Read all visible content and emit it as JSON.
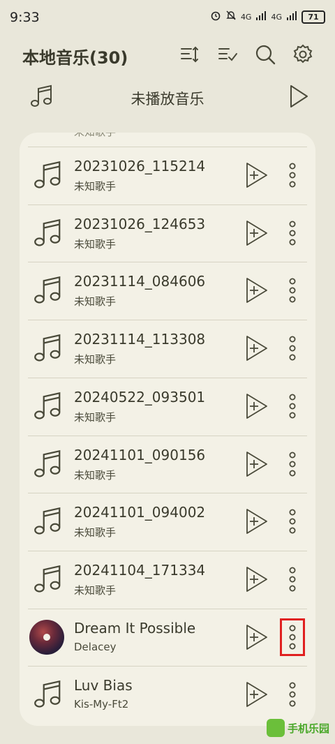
{
  "status_bar": {
    "time": "9:33",
    "signal_1": "4G",
    "signal_2": "4G",
    "battery": "71"
  },
  "header": {
    "title": "本地音乐(30)",
    "icons": [
      "sort-icon",
      "multi-select-icon",
      "search-icon",
      "settings-icon"
    ]
  },
  "unplayed": {
    "label": "未播放音乐"
  },
  "list": {
    "partial_top_text": "未知歌手",
    "rows": [
      {
        "title": "20231026_115214",
        "artist": "未知歌手",
        "art": false
      },
      {
        "title": "20231026_124653",
        "artist": "未知歌手",
        "art": false
      },
      {
        "title": "20231114_084606",
        "artist": "未知歌手",
        "art": false
      },
      {
        "title": "20231114_113308",
        "artist": "未知歌手",
        "art": false
      },
      {
        "title": "20240522_093501",
        "artist": "未知歌手",
        "art": false
      },
      {
        "title": "20241101_090156",
        "artist": "未知歌手",
        "art": false
      },
      {
        "title": "20241101_094002",
        "artist": "未知歌手",
        "art": false
      },
      {
        "title": "20241104_171334",
        "artist": "未知歌手",
        "art": false
      },
      {
        "title": "Dream It Possible",
        "artist": "Delacey",
        "art": true
      },
      {
        "title": "Luv Bias",
        "artist": "Kis-My-Ft2",
        "art": false
      }
    ]
  },
  "colors": {
    "background": "#e9e7da",
    "card": "#f3f1e6",
    "icon": "#4a4a3a",
    "highlight": "#e02020"
  },
  "watermark": "手机乐园"
}
